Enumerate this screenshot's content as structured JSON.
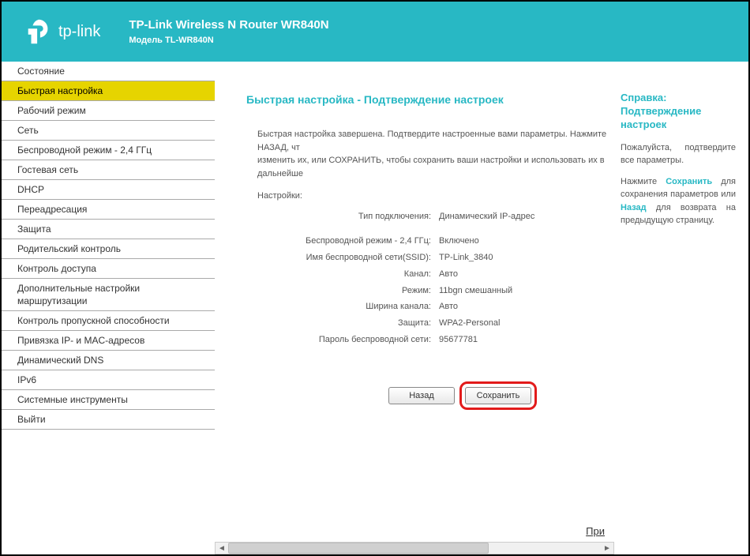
{
  "header": {
    "brand": "tp-link",
    "title": "TP-Link Wireless N Router WR840N",
    "model": "Модель TL-WR840N"
  },
  "sidebar": {
    "items": [
      "Состояние",
      "Быстрая настройка",
      "Рабочий режим",
      "Сеть",
      "Беспроводной режим - 2,4 ГГц",
      "Гостевая сеть",
      "DHCP",
      "Переадресация",
      "Защита",
      "Родительский контроль",
      "Контроль доступа",
      "Дополнительные настройки маршрутизации",
      "Контроль пропускной способности",
      "Привязка IP- и MAC-адресов",
      "Динамический DNS",
      "IPv6",
      "Системные инструменты",
      "Выйти"
    ],
    "activeIndex": 1
  },
  "main": {
    "title": "Быстрая настройка - Подтверждение настроек",
    "intro": "Быстрая настройка завершена. Подтвердите настроенные вами параметры. Нажмите НАЗАД, чт\nизменить их, или СОХРАНИТЬ, чтобы сохранить ваши настройки и использовать их в дальнейше",
    "settings_label": "Настройки:",
    "rows": [
      {
        "k": "Тип подключения:",
        "v": "Динамический IP-адрес"
      },
      {
        "k": "Беспроводной режим - 2,4 ГГц:",
        "v": "Включено"
      },
      {
        "k": "Имя беспроводной сети(SSID):",
        "v": "TP-Link_3840"
      },
      {
        "k": "Канал:",
        "v": "Авто"
      },
      {
        "k": "Режим:",
        "v": "11bgn смешанный"
      },
      {
        "k": "Ширина канала:",
        "v": "Авто"
      },
      {
        "k": "Защита:",
        "v": "WPA2-Personal"
      },
      {
        "k": "Пароль беспроводной сети:",
        "v": "95677781"
      }
    ],
    "back_label": "Назад",
    "save_label": "Сохранить",
    "footer_link": "При"
  },
  "help": {
    "title": "Справка: Подтверждение настроек",
    "p1": "Пожалуйста, подтвердите все параметры.",
    "p2_pre": "Нажмите ",
    "p2_hl1": "Сохранить",
    "p2_mid": " для сохранения параметров или ",
    "p2_hl2": "Назад",
    "p2_post": " для возврата на предыдущую страницу."
  }
}
